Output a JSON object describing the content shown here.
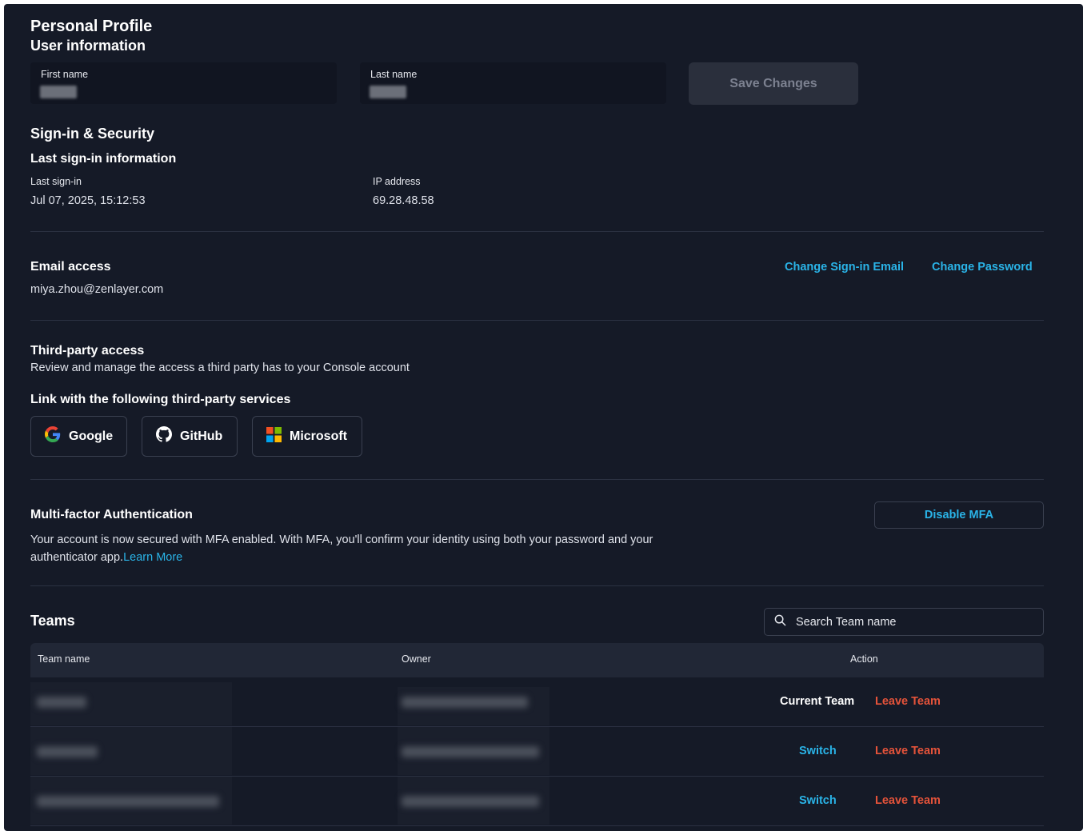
{
  "profile": {
    "title": "Personal Profile",
    "subtitle": "User information",
    "first_name_label": "First name",
    "last_name_label": "Last name",
    "save_label": "Save Changes"
  },
  "security": {
    "title": "Sign-in & Security",
    "last_signin_heading": "Last sign-in information",
    "last_signin_label": "Last sign-in",
    "last_signin_value": "Jul 07, 2025, 15:12:53",
    "ip_label": "IP address",
    "ip_value": "69.28.48.58"
  },
  "email": {
    "title": "Email access",
    "value": "miya.zhou@zenlayer.com",
    "change_email_label": "Change Sign-in Email",
    "change_password_label": "Change Password"
  },
  "third_party": {
    "title": "Third-party access",
    "description": "Review and manage the access a third party has to your Console account",
    "link_heading": "Link with the following third-party services",
    "services": [
      {
        "label": "Google",
        "icon": "google-icon"
      },
      {
        "label": "GitHub",
        "icon": "github-icon"
      },
      {
        "label": "Microsoft",
        "icon": "microsoft-icon"
      }
    ]
  },
  "mfa": {
    "title": "Multi-factor Authentication",
    "description_line1": "Your account is now secured with MFA enabled. With MFA, you'll confirm your identity using both your password and your",
    "description_line2": "authenticator app.",
    "learn_more": "Learn More",
    "disable_label": "Disable MFA"
  },
  "teams": {
    "title": "Teams",
    "search_placeholder": "Search Team name",
    "columns": [
      "Team name",
      "Owner",
      "Action"
    ],
    "rows": [
      {
        "action_primary": "Current Team",
        "action_secondary": "Leave Team"
      },
      {
        "action_primary": "Switch",
        "action_secondary": "Leave Team"
      },
      {
        "action_primary": "Switch",
        "action_secondary": "Leave Team"
      }
    ]
  },
  "colors": {
    "background": "#151a27",
    "accent": "#2ab4e8",
    "danger": "#e5533a"
  }
}
